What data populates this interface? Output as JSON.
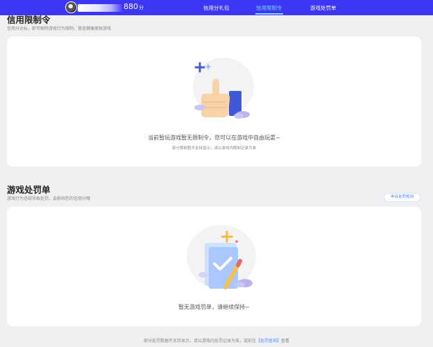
{
  "header": {
    "score": "880",
    "score_unit": "分",
    "tabs": [
      {
        "label": "信用分礼包"
      },
      {
        "label": "信用限制令"
      },
      {
        "label": "游戏处罚单"
      }
    ],
    "active_tab": "信用限制令",
    "accent": "#3d36f5"
  },
  "restriction": {
    "title": "信用限制令",
    "subtitle": "信用分达标，即可解除游戏行为限制，营造健康度娱游戏",
    "empty_message": "当前暂玩游戏暂无限制令，您可以在游戏中自由玩耍~",
    "note": "部分限制暂不支持显示，请以游戏内限制记录为准"
  },
  "penalty": {
    "title": "游戏处罚单",
    "subtitle": "游戏行为违规导致处罚，会影响您的信用分哦",
    "link_label": "申诉处罚规则",
    "empty_message": "暂无游戏罚单，请继续保持~"
  },
  "footer": {
    "text_before": "部分处罚数据不支持显示，请以游戏内处罚记录为准，或前往",
    "link": "【处罚查询】",
    "text_after": "查看"
  }
}
